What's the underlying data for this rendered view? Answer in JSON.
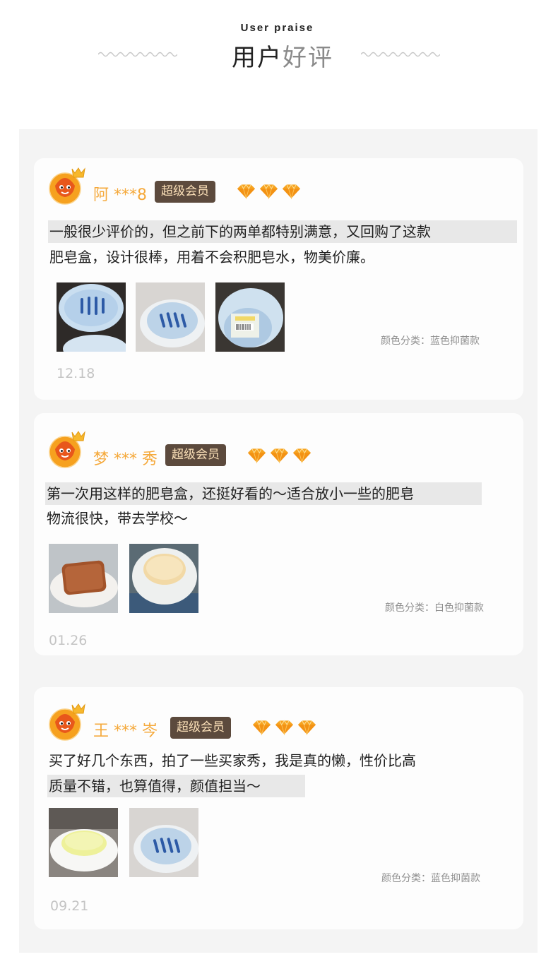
{
  "header": {
    "subtitle": "User praise",
    "title_part1": "用户",
    "title_part2": "好评"
  },
  "reviews": [
    {
      "user": "阿 ***8",
      "badge": "超级会员",
      "rating": 3,
      "lines": [
        "一般很少评价的，但之前下的两单都特别满意，又回购了这款",
        "肥皂盒，设计很棒，用着不会积肥皂水，物美价廉。"
      ],
      "photos": [
        "blue-soap-dish-photo",
        "blue-soap-dish-photo",
        "packaged-soap-dish-photo"
      ],
      "variant": "颜色分类：蓝色抑菌款",
      "date": "12.18"
    },
    {
      "user": "梦 *** 秀",
      "badge": "超级会员",
      "rating": 3,
      "lines": [
        "第一次用这样的肥皂盒，还挺好看的～适合放小一些的肥皂",
        "物流很快，带去学校～"
      ],
      "photos": [
        "brown-soap-photo",
        "white-soap-photo"
      ],
      "variant": "颜色分类：白色抑菌款",
      "date": "01.26"
    },
    {
      "user": "王 *** 岑",
      "badge": "超级会员",
      "rating": 3,
      "lines": [
        "买了好几个东西，拍了一些买家秀，我是真的懒，性价比高",
        "质量不错，也算值得，颜值担当～"
      ],
      "photos": [
        "yellow-soap-photo",
        "blue-soap-dish-photo"
      ],
      "variant": "颜色分类：蓝色抑菌款",
      "date": "09.21"
    }
  ],
  "colors": {
    "username": "#f5a93b",
    "badge_bg": "#5c4a3d",
    "badge_text": "#fbe0b8",
    "diamond": "#f7a421",
    "highlight": "#e8e8e8"
  }
}
